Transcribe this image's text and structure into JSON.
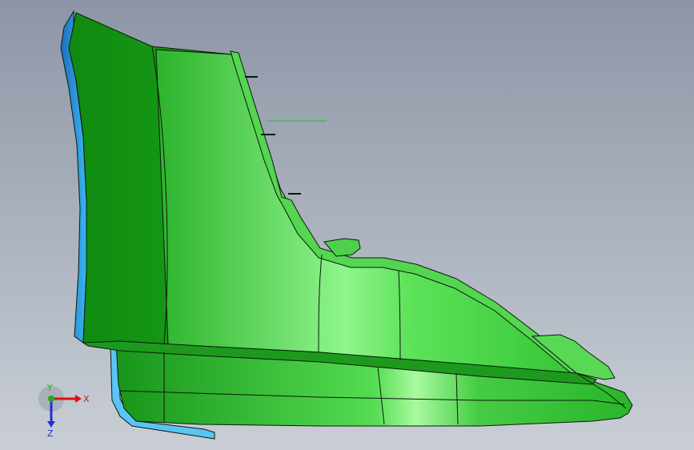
{
  "viewport": {
    "background_top": "#8d96a6",
    "background_bottom": "#c9ced6"
  },
  "model": {
    "primary_color": "#3fd23f",
    "highlight_color": "#8ff58c",
    "shadow_color": "#128812",
    "secondary_color": "#3ab4f0",
    "edge_color": "#0a1a0a"
  },
  "triad": {
    "x_label": "X",
    "y_label": "Y",
    "z_label": "Z",
    "x_color": "#e01010",
    "y_color": "#18b018",
    "z_color": "#2030d0"
  }
}
